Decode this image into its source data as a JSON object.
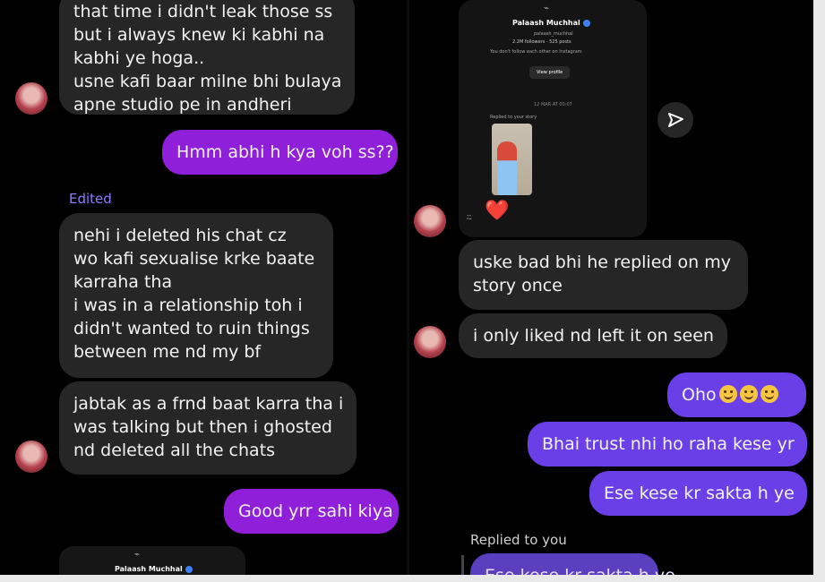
{
  "left": {
    "msg1_lines": [
      "that time i didn't leak those ss",
      "but i always knew ki kabhi na",
      "kabhi ye hoga..",
      "usne kafi baar milne bhi bulaya",
      "apne studio pe in andheri"
    ],
    "out1": "Hmm abhi h kya voh ss??",
    "edited_label": "Edited",
    "msg2_lines": [
      "nehi i deleted his chat cz",
      "wo kafi sexualise krke baate",
      "karraha tha",
      "i was in a relationship toh i",
      "didn't wanted to ruin things",
      "between me nd my bf"
    ],
    "msg3_lines": [
      "jabtak as a frnd baat karra tha i",
      "was talking but then i ghosted",
      "nd deleted all the chats"
    ],
    "out2": "Good yrr sahi kiya",
    "card_name": "Palaash Muchhal"
  },
  "right": {
    "card": {
      "name": "Palaash Muchhal",
      "handle": "palaash_muchhal",
      "stats": "2.2M followers · 525 posts",
      "follow_note": "You don't follow each other on Instagram",
      "view_profile": "View profile",
      "timestamp": "12 MAR AT 00:07",
      "replied_story": "Replied to your story"
    },
    "reaction_emoji": "❤️",
    "msg1_lines": [
      "uske bad bhi he replied on my",
      "story once"
    ],
    "msg2": "i only liked nd left it on seen",
    "out1": "Oho",
    "out2": "Bhai trust nhi ho raha kese yr",
    "out3": "Ese kese kr sakta h ye",
    "replied_label": "Replied to you",
    "reply_preview": "Ese kese kr sakta h ye"
  },
  "colors": {
    "incoming_bubble": "#262626",
    "outgoing_purple": "#8f1fd8",
    "outgoing_blue": "#6a3fe7",
    "edited": "#8b7bff"
  },
  "icons": [
    "send-icon",
    "verified-icon",
    "heart-icon",
    "avatar"
  ]
}
